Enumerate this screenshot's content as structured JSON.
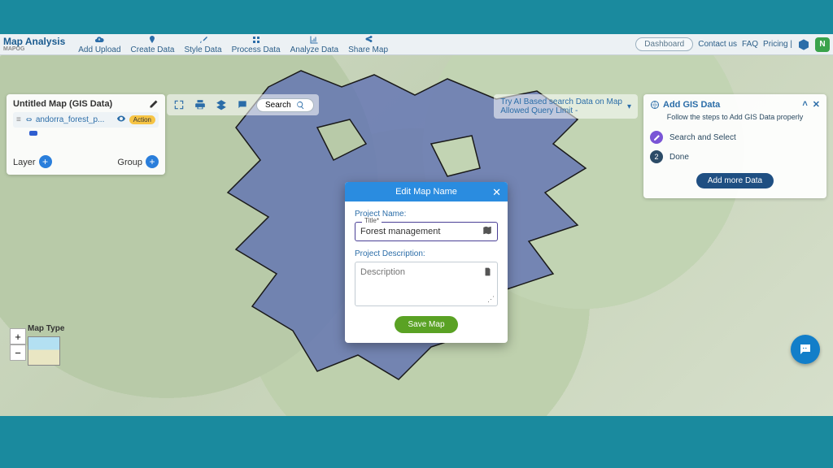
{
  "brand": {
    "title": "Map Analysis",
    "subtitle": "MAPOG"
  },
  "toolbar": {
    "items": [
      {
        "label": "Add Upload"
      },
      {
        "label": "Create Data"
      },
      {
        "label": "Style Data"
      },
      {
        "label": "Process Data"
      },
      {
        "label": "Analyze Data"
      },
      {
        "label": "Share Map"
      }
    ],
    "dashboard": "Dashboard",
    "contact": "Contact us",
    "faq": "FAQ",
    "pricing": "Pricing |",
    "avatar_initial": "N"
  },
  "toolstrip": {
    "search_label": "Search"
  },
  "layers_panel": {
    "title": "Untitled Map (GIS Data)",
    "layer_name": "andorra_forest_p...",
    "action_chip": "Action",
    "layer_label": "Layer",
    "group_label": "Group"
  },
  "ai_banner": {
    "line1": "Try AI Based search Data on Map",
    "line2": "Allowed Query Limit -"
  },
  "gis_panel": {
    "title": "Add GIS Data",
    "subtitle": "Follow the steps to Add GIS Data properly",
    "step1": "Search and Select",
    "step2": "Done",
    "step2_num": "2",
    "add_more": "Add more Data"
  },
  "maptype_label": "Map Type",
  "modal": {
    "title": "Edit Map Name",
    "project_name_label": "Project Name:",
    "title_float": "Title*",
    "title_value": "Forest management",
    "desc_label": "Project Description:",
    "desc_placeholder": "Description",
    "save": "Save Map"
  }
}
